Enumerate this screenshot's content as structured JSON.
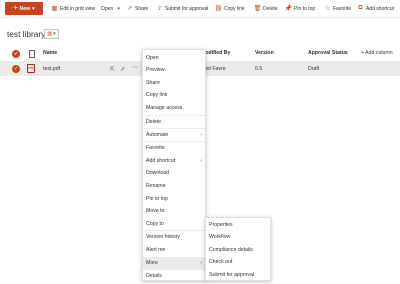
{
  "toolbar": {
    "new_label": "New",
    "edit_grid": "Edit in grid view",
    "open": "Open",
    "share": "Share",
    "submit_approval": "Submit for approval",
    "copy_link": "Copy link",
    "delete": "Delete",
    "pin_to_top": "Pin to top",
    "favorite": "Favorite",
    "add_shortcut": "Add shortcut"
  },
  "library": {
    "title": "test library"
  },
  "columns": {
    "name": "Name",
    "modified_by": "Modified By",
    "version": "Version",
    "approval_status": "Approval Status",
    "add_column": "+ Add column"
  },
  "rows": [
    {
      "name": "test.pdf",
      "modified_by": "Trist Favre",
      "version": "0.5",
      "approval_status": "Draft"
    }
  ],
  "context_menu": {
    "items": [
      "Open",
      "Preview",
      "Share",
      "Copy link",
      "Manage access",
      "Delete",
      "Automate",
      "Favorite",
      "Add shortcut",
      "Download",
      "Rename",
      "Pin to top",
      "Move to",
      "Copy to",
      "Version history",
      "Alert me",
      "More",
      "Details"
    ]
  },
  "submenu": {
    "items": [
      "Properties",
      "Workflow",
      "Compliance details",
      "Check out",
      "Submit for approval"
    ]
  },
  "colors": {
    "accent": "#c8431f",
    "row_selected": "#edebe9"
  }
}
